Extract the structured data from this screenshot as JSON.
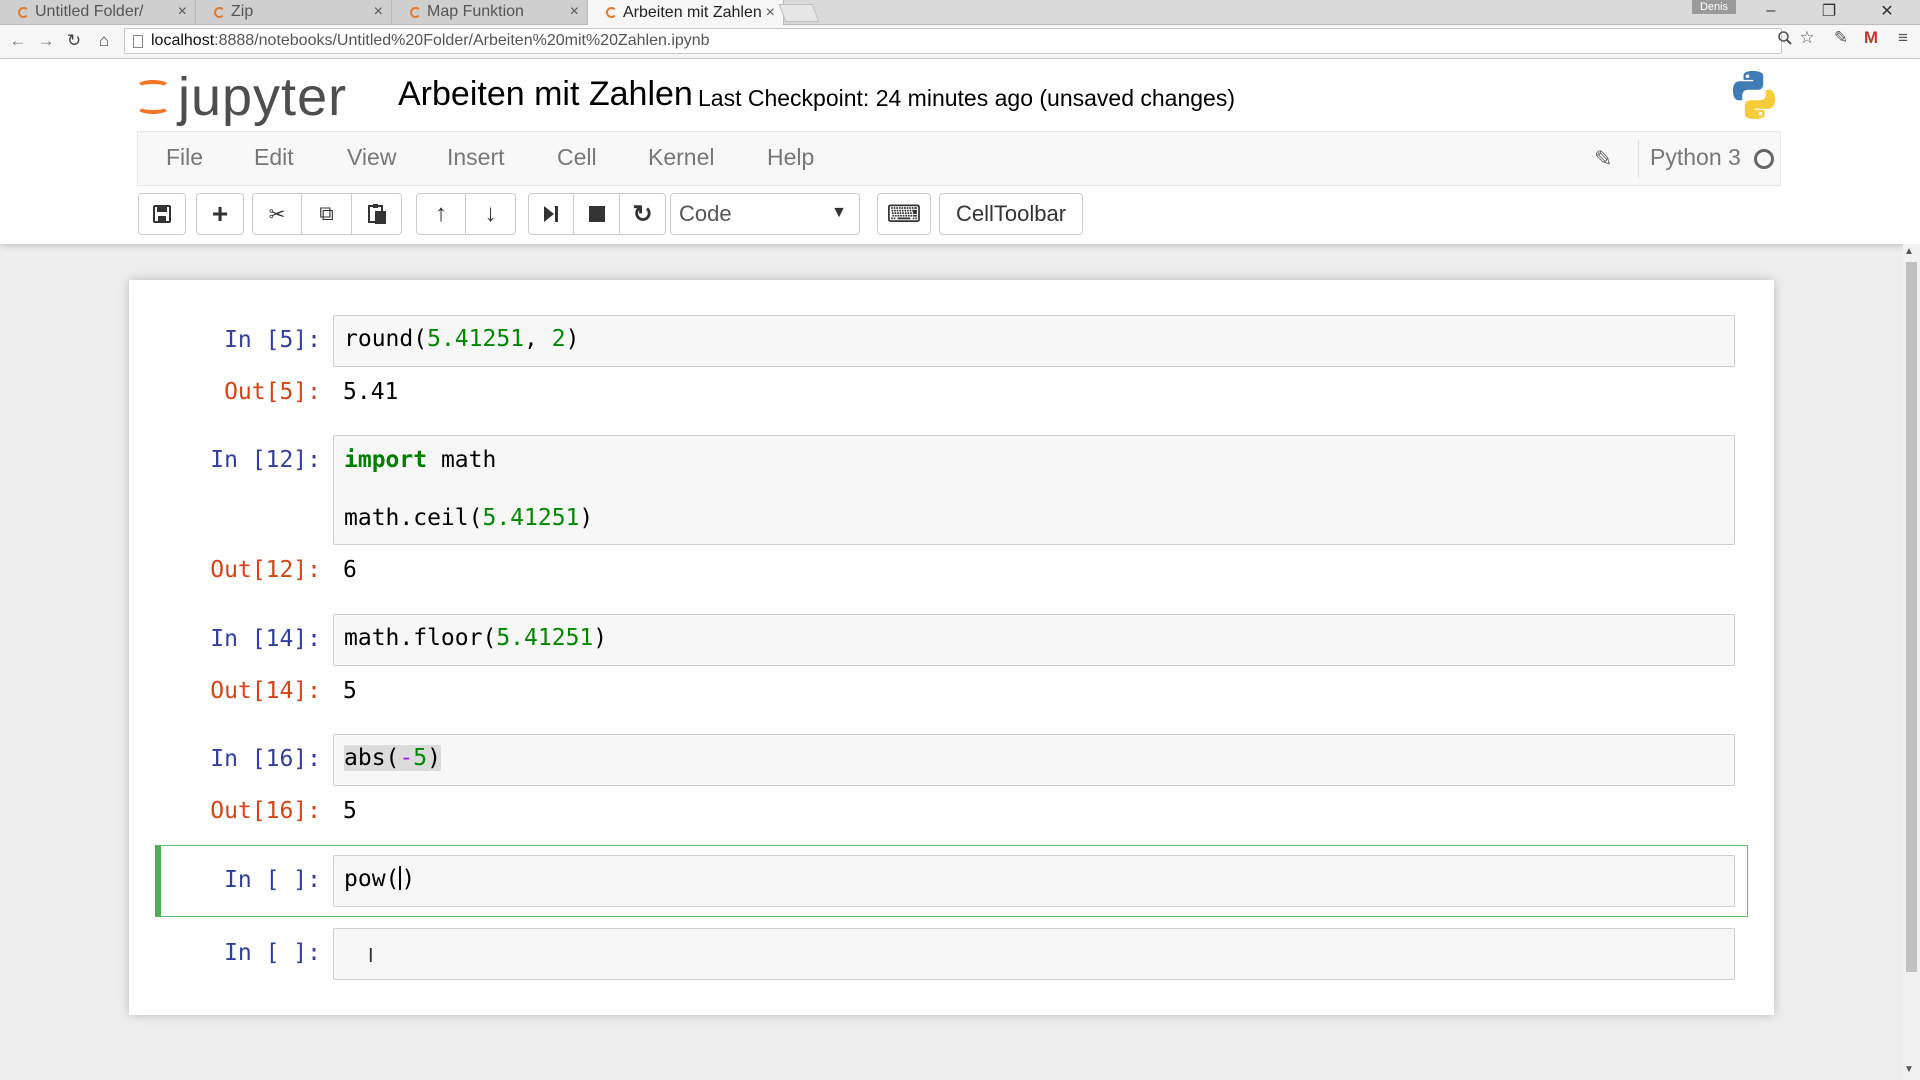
{
  "browser": {
    "tabs": [
      {
        "label": "Untitled Folder/",
        "close": "×",
        "active": false
      },
      {
        "label": "Zip",
        "close": "×",
        "active": false
      },
      {
        "label": "Map Funktion",
        "close": "×",
        "active": false
      },
      {
        "label": "Arbeiten mit Zahlen",
        "close": "×",
        "active": true
      }
    ],
    "profile_name": "Denis",
    "window_controls": {
      "minimize": "–",
      "restore": "❐",
      "close": "✕"
    },
    "nav": {
      "back": "←",
      "forward": "→",
      "reload": "↻",
      "home": "⌂"
    },
    "url_host": "localhost",
    "url_rest": ":8888/notebooks/Untitled%20Folder/Arbeiten%20mit%20Zahlen.ipynb",
    "address_icons": {
      "zoom": "🔍",
      "star": "☆",
      "ext": "✎",
      "gmail": "M",
      "menu": "≡"
    }
  },
  "jupyter": {
    "logo_text": "jupyter",
    "notebook_title": "Arbeiten mit Zahlen",
    "checkpoint_text": "Last Checkpoint: 24 minutes ago (unsaved changes)",
    "menu": [
      "File",
      "Edit",
      "View",
      "Insert",
      "Cell",
      "Kernel",
      "Help"
    ],
    "kernel_name": "Python 3",
    "cell_type_selected": "Code",
    "celltoolbar_label": "CellToolbar",
    "toolbar_icons": {
      "save": "💾",
      "add": "+",
      "cut": "✂",
      "copy": "⧉",
      "paste": "📋",
      "move_up": "↑",
      "move_down": "↓",
      "run": "⏭",
      "stop": "■",
      "restart": "↻",
      "keyboard": "⌨",
      "caret": "▼",
      "pencil": "✎"
    }
  },
  "cells": [
    {
      "prompt_in": "In [5]:",
      "prompt_out": "Out[5]:",
      "output": "5.41",
      "code": {
        "fn": "round(",
        "num1": "5.41251",
        "sep": ", ",
        "num2": "2",
        "end": ")"
      }
    },
    {
      "prompt_in": "In [12]:",
      "prompt_out": "Out[12]:",
      "output": "6",
      "code": {
        "kw": "import",
        "mod": " math",
        "fn": "math.ceil(",
        "num": "5.41251",
        "end": ")"
      }
    },
    {
      "prompt_in": "In [14]:",
      "prompt_out": "Out[14]:",
      "output": "5",
      "code": {
        "fn": "math.floor(",
        "num": "5.41251",
        "end": ")"
      }
    },
    {
      "prompt_in": "In [16]:",
      "prompt_out": "Out[16]:",
      "output": "5",
      "code": {
        "fn": "abs(",
        "op": "-",
        "num": "5",
        "end": ")"
      }
    },
    {
      "prompt_in": "In [ ]:",
      "code": {
        "fn": "pow(",
        "end": ")"
      }
    },
    {
      "prompt_in": "In [ ]:",
      "code": {}
    }
  ],
  "colors": {
    "prompt_in": "#303f9f",
    "prompt_out": "#d84315",
    "selected_cell_border": "#4caf50",
    "logo_orange": "#f37726"
  }
}
